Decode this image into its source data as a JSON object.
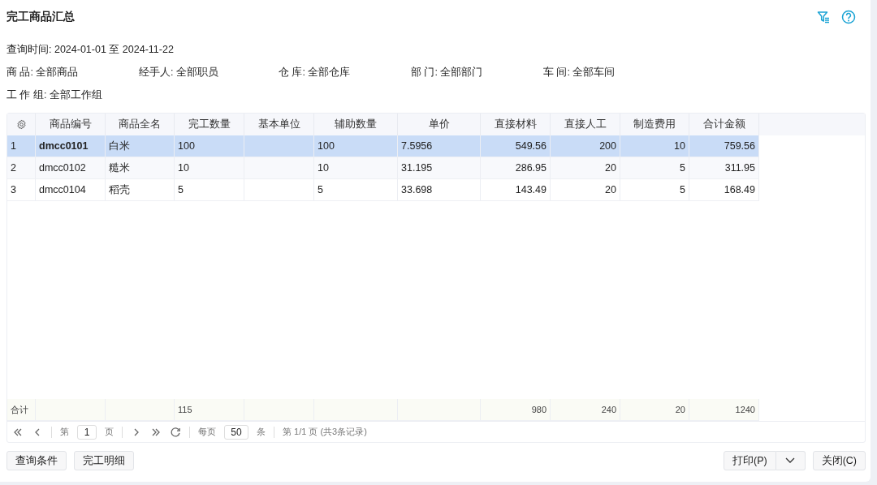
{
  "window": {
    "title": "完工商品汇总"
  },
  "query_time": "查询时间: 2024-01-01 至 2024-11-22",
  "filters": [
    {
      "label": "商 品:",
      "value": "全部商品"
    },
    {
      "label": "经手人:",
      "value": "全部职员"
    },
    {
      "label": "仓 库:",
      "value": "全部仓库"
    },
    {
      "label": "部 门:",
      "value": "全部部门"
    },
    {
      "label": "车 间:",
      "value": "全部车间"
    },
    {
      "label": "工 作 组:",
      "value": "全部工作组"
    }
  ],
  "table": {
    "columns": [
      {
        "title": "商品编号",
        "kind": "text"
      },
      {
        "title": "商品全名",
        "kind": "text"
      },
      {
        "title": "完工数量",
        "kind": "text"
      },
      {
        "title": "基本单位",
        "kind": "text"
      },
      {
        "title": "辅助数量",
        "kind": "text"
      },
      {
        "title": "单价",
        "kind": "text"
      },
      {
        "title": "直接材料",
        "kind": "amount"
      },
      {
        "title": "直接人工",
        "kind": "amount"
      },
      {
        "title": "制造费用",
        "kind": "amount"
      },
      {
        "title": "合计金额",
        "kind": "amount"
      }
    ],
    "rows": [
      {
        "index": "1",
        "selected": true,
        "cells": [
          "dmcc0101",
          "白米",
          "100",
          null,
          "100",
          "7.5956",
          "549.56",
          "200",
          "10",
          "759.56"
        ]
      },
      {
        "index": "2",
        "selected": false,
        "cells": [
          "dmcc0102",
          "糙米",
          "10",
          null,
          "10",
          "31.195",
          "286.95",
          "20",
          "5",
          "311.95"
        ]
      },
      {
        "index": "3",
        "selected": false,
        "cells": [
          "dmcc0104",
          "稻壳",
          "5",
          null,
          "5",
          "33.698",
          "143.49",
          "20",
          "5",
          "168.49"
        ]
      }
    ],
    "totals": {
      "label": "合计",
      "cells": [
        null,
        null,
        "115",
        null,
        null,
        null,
        "980",
        "240",
        "20",
        "1240"
      ]
    }
  },
  "pager": {
    "page_prefix": "第",
    "page": "1",
    "page_suffix": "页",
    "per_page_prefix": "每页",
    "per_page": "50",
    "per_page_suffix": "条",
    "summary": "第 1/1 页 (共3条记录)"
  },
  "buttons_left": [
    "查询条件",
    "完工明细"
  ],
  "print_button": "打印(P)",
  "close_button": "关闭(C)"
}
